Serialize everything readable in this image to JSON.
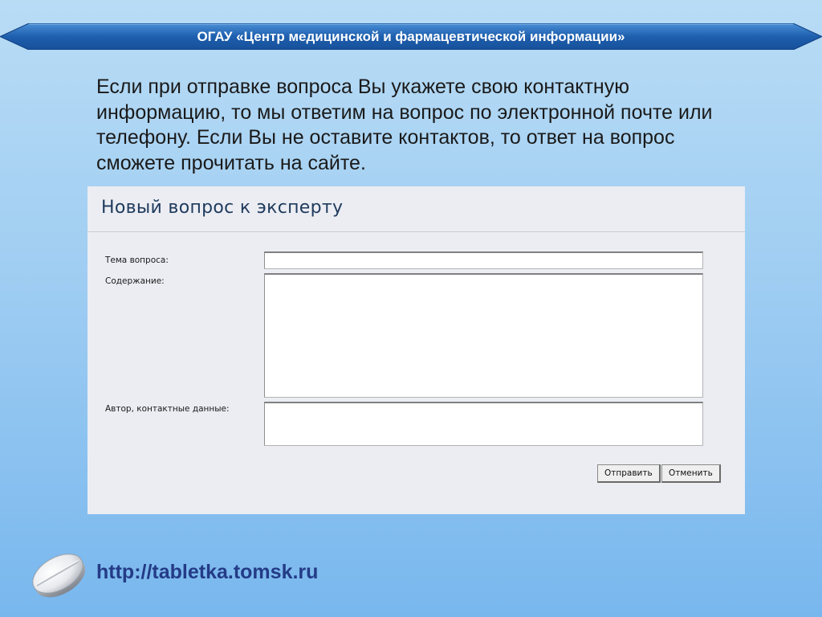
{
  "header": {
    "title": "ОГАУ «Центр медицинской и фармацевтической информации»"
  },
  "intro": {
    "text": "Если при отправке вопроса Вы укажете свою контактную информацию, то мы ответим на вопрос по электронной почте или телефону. Если Вы не оставите контактов, то ответ на вопрос сможете прочитать на сайте."
  },
  "form": {
    "title": "Новый вопрос к эксперту",
    "subject_label": "Тема вопроса:",
    "subject_value": "",
    "content_label": "Содержание:",
    "content_value": "",
    "author_label": "Автор, контактные данные:",
    "author_value": "",
    "submit_label": "Отправить",
    "cancel_label": "Отменить"
  },
  "footer": {
    "url": "http://tabletka.tomsk.ru",
    "logo_icon": "pill-icon"
  },
  "colors": {
    "banner": "#1e5fae",
    "panel": "#ebedf3",
    "url_text": "#243b86"
  }
}
